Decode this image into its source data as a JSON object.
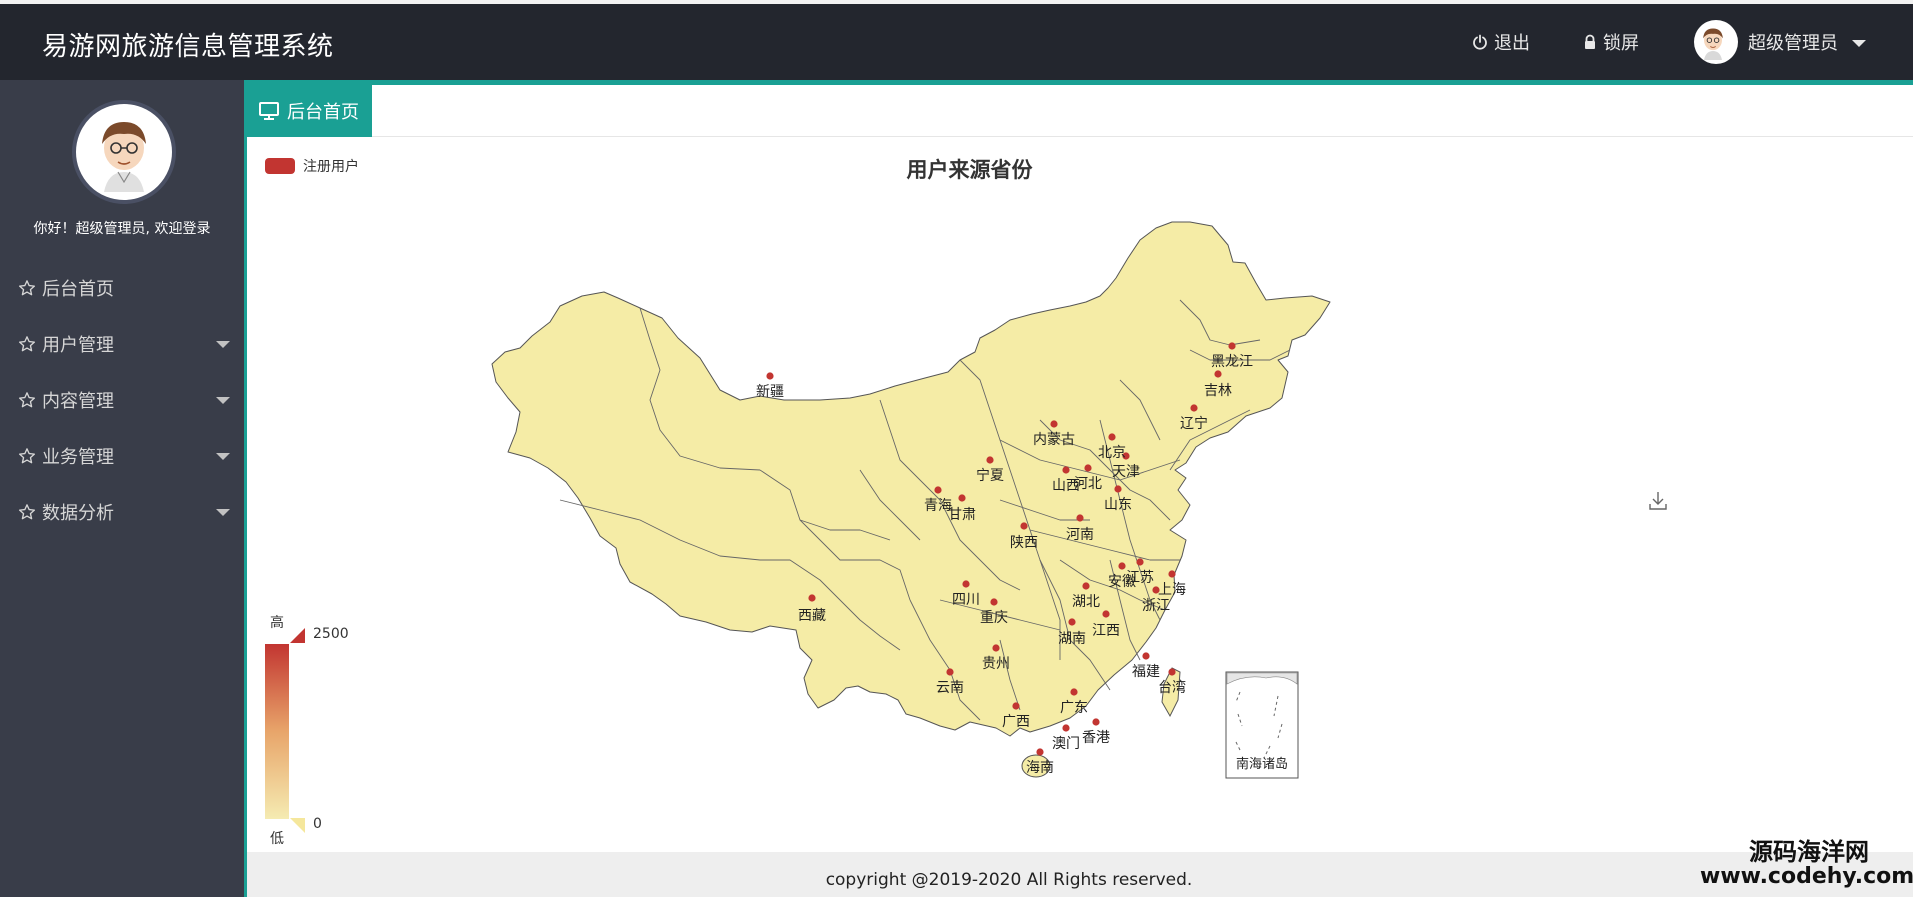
{
  "header": {
    "app_title": "易游网旅游信息管理系统",
    "logout_label": "退出",
    "lock_label": "锁屏",
    "user_label": "超级管理员",
    "logout_icon": "power-icon",
    "lock_icon": "lock-icon"
  },
  "sidebar": {
    "welcome": "你好！超级管理员, 欢迎登录",
    "items": [
      {
        "label": "后台首页",
        "icon": "star-icon",
        "has_submenu": false
      },
      {
        "label": "用户管理",
        "icon": "star-icon",
        "has_submenu": true
      },
      {
        "label": "内容管理",
        "icon": "star-icon",
        "has_submenu": true
      },
      {
        "label": "业务管理",
        "icon": "star-icon",
        "has_submenu": true
      },
      {
        "label": "数据分析",
        "icon": "star-icon",
        "has_submenu": true
      }
    ]
  },
  "tabs": [
    {
      "label": "后台首页",
      "icon": "monitor-icon",
      "active": true
    }
  ],
  "chart_data": {
    "type": "map",
    "title": "用户来源省份",
    "legend": [
      "注册用户"
    ],
    "series": [
      {
        "name": "注册用户",
        "color": "#c23531"
      }
    ],
    "visual_map": {
      "max": 2500,
      "min": 0,
      "high_label": "高",
      "low_label": "低",
      "colors": [
        "#c23531",
        "#e8a56a",
        "#f5ebb2"
      ]
    },
    "provinces": [
      "新疆",
      "西藏",
      "青海",
      "甘肃",
      "宁夏",
      "内蒙古",
      "黑龙江",
      "吉林",
      "辽宁",
      "北京",
      "天津",
      "河北",
      "山西",
      "山东",
      "陕西",
      "河南",
      "四川",
      "重庆",
      "湖北",
      "安徽",
      "江苏",
      "上海",
      "浙江",
      "湖南",
      "江西",
      "贵州",
      "云南",
      "福建",
      "台湾",
      "广西",
      "广东",
      "香港",
      "澳门",
      "海南"
    ],
    "inset_label": "南海诸岛",
    "map_fill": "#f5eca6"
  },
  "footer": {
    "copyright": "copyright @2019-2020 All Rights reserved."
  },
  "watermark": {
    "line1": "源码海洋网",
    "line2": "www.codehy.com"
  }
}
